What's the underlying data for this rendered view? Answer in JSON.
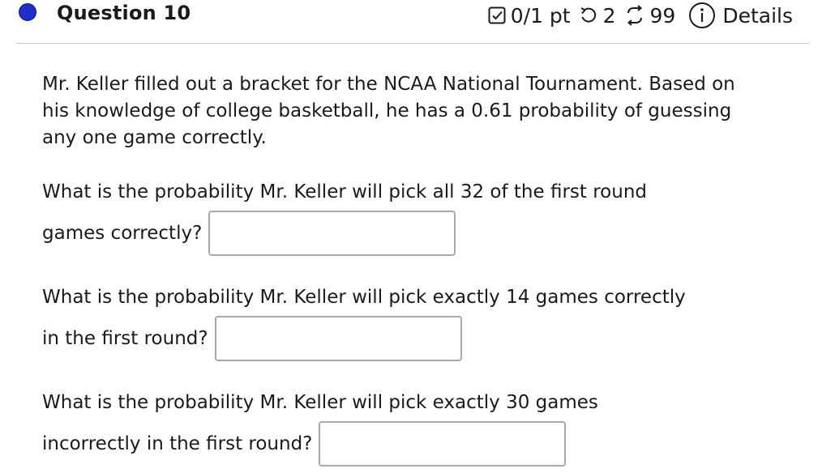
{
  "question": {
    "title": "Question 10",
    "score": "0/1 pt",
    "retries": "2",
    "attempts": "99",
    "details_label": "Details"
  },
  "body": {
    "intro": "Mr. Keller filled out a bracket for the NCAA National Tournament. Based on his knowledge of college basketball, he has a 0.61 probability of guessing any one game correctly.",
    "parts": [
      {
        "prompt_line1": "What is the probability Mr. Keller will pick all 32 of the first round",
        "prompt_line2": "games correctly?",
        "answer": ""
      },
      {
        "prompt_line1": "What is the probability Mr. Keller will pick exactly 14 games correctly",
        "prompt_line2": "in the first round?",
        "answer": ""
      },
      {
        "prompt_line1": "What is the probability Mr. Keller will pick exactly 30 games",
        "prompt_line2": "incorrectly in the first round?",
        "answer": ""
      }
    ]
  },
  "colors": {
    "status_dot": "#1f2fc9",
    "divider": "#c9c9c9",
    "input_border": "#a9a9a9"
  },
  "icons": [
    "status-dot-icon",
    "checkbox-icon",
    "retry-icon",
    "attempts-icon",
    "info-icon"
  ]
}
